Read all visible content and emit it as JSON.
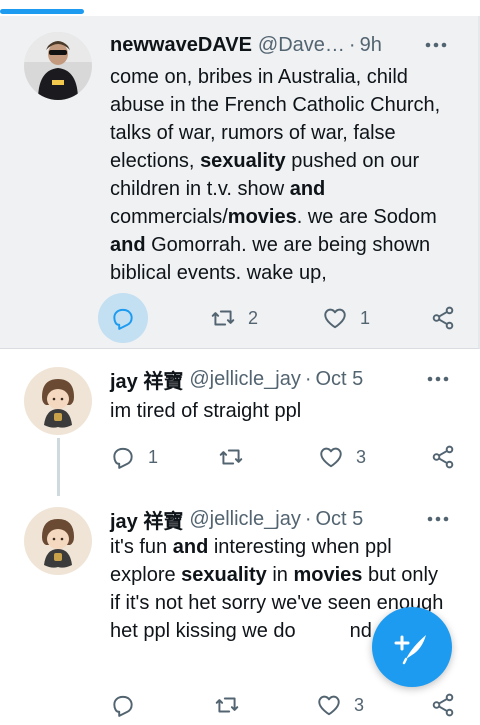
{
  "colors": {
    "accent": "#1d9bf0",
    "muted": "#536471",
    "highlight_bg": "#eff1f3"
  },
  "tweets": [
    {
      "display_name": "newwaveDAVE",
      "handle": "@Dave…",
      "separator": "·",
      "time": "9h",
      "text_parts": [
        "come on, bribes in Australia, child abuse in the French Catholic Church, talks of war, rumors of war, false elections, ",
        "sexuality",
        " pushed on our children in t.v. show ",
        "and",
        " commercials/",
        "movies",
        ". we are Sodom ",
        "and",
        " Gomorrah. we are being shown biblical events. wake up,"
      ],
      "reply_count": "",
      "retweet_count": "2",
      "like_count": "1",
      "avatar_icon": "user-avatar-icon"
    },
    {
      "display_name": "jay 祥寶",
      "handle": "@jellicle_jay",
      "separator": "·",
      "time": "Oct 5",
      "text": "im tired of straight ppl",
      "reply_count": "1",
      "retweet_count": "",
      "like_count": "3",
      "avatar_icon": "user-avatar-icon"
    },
    {
      "display_name": "jay 祥寶",
      "handle": "@jellicle_jay",
      "separator": "·",
      "time": "Oct 5",
      "text_parts": [
        "it's fun ",
        "and",
        " interesting when ppl explore ",
        "sexuality",
        " in ",
        "movies",
        " but only if it's not het sorry we've seen enough het ppl kissing we do",
        "",
        "nd more"
      ],
      "reply_count": "",
      "retweet_count": "",
      "like_count": "3",
      "avatar_icon": "user-avatar-icon"
    }
  ],
  "fab": {
    "icon": "compose-tweet-icon"
  }
}
